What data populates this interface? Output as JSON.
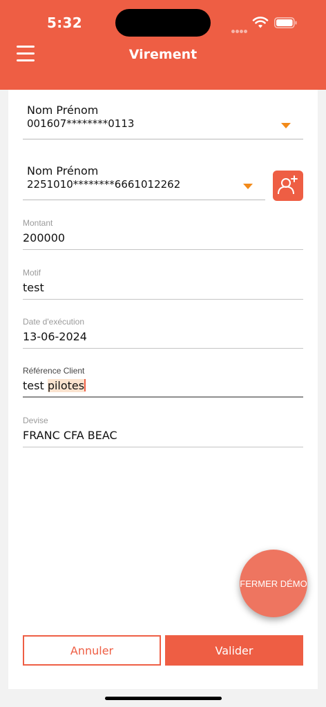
{
  "status_bar": {
    "time": "5:32"
  },
  "header": {
    "title": "Virement"
  },
  "source_account": {
    "name": "Nom Prénom",
    "number": "001607********0113"
  },
  "beneficiary_account": {
    "name": "Nom Prénom",
    "number": "2251010********6661012262"
  },
  "fields": {
    "amount": {
      "label": "Montant",
      "value": "200000"
    },
    "reason": {
      "label": "Motif",
      "value": "test"
    },
    "execution_date": {
      "label": "Date d'exécution",
      "value": "13-06-2024"
    },
    "client_reference": {
      "label": "Référence Client",
      "value_plain": "test ",
      "value_selected": "pilotes"
    },
    "currency": {
      "label": "Devise",
      "value": "FRANC CFA BEAC"
    }
  },
  "demo_button": {
    "label": "FERMER DÉMO"
  },
  "actions": {
    "cancel": "Annuler",
    "submit": "Valider"
  },
  "colors": {
    "brand": "#ee5e44",
    "caret": "#f28a1a",
    "selection": "#fbe3cf"
  },
  "icons": {
    "menu": "hamburger-icon",
    "add_contact": "add-contact-icon",
    "dropdown": "chevron-down-icon"
  }
}
